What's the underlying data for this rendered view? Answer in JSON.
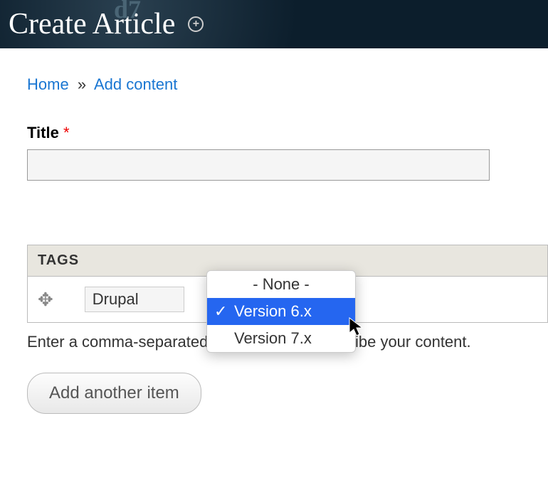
{
  "header": {
    "title": "Create Article",
    "decor": "d7"
  },
  "breadcrumb": {
    "home": "Home",
    "sep": "»",
    "add": "Add content"
  },
  "title_field": {
    "label": "Title",
    "required_marker": "*",
    "value": ""
  },
  "tags": {
    "header": "TAGS",
    "row": {
      "tag_value": "Drupal"
    },
    "help": "Enter a comma-separated list of words to describe your content.",
    "add_button": "Add another item"
  },
  "dropdown": {
    "options": [
      {
        "label": "- None -",
        "selected": false
      },
      {
        "label": "Version 6.x",
        "selected": true
      },
      {
        "label": "Version 7.x",
        "selected": false
      }
    ]
  }
}
